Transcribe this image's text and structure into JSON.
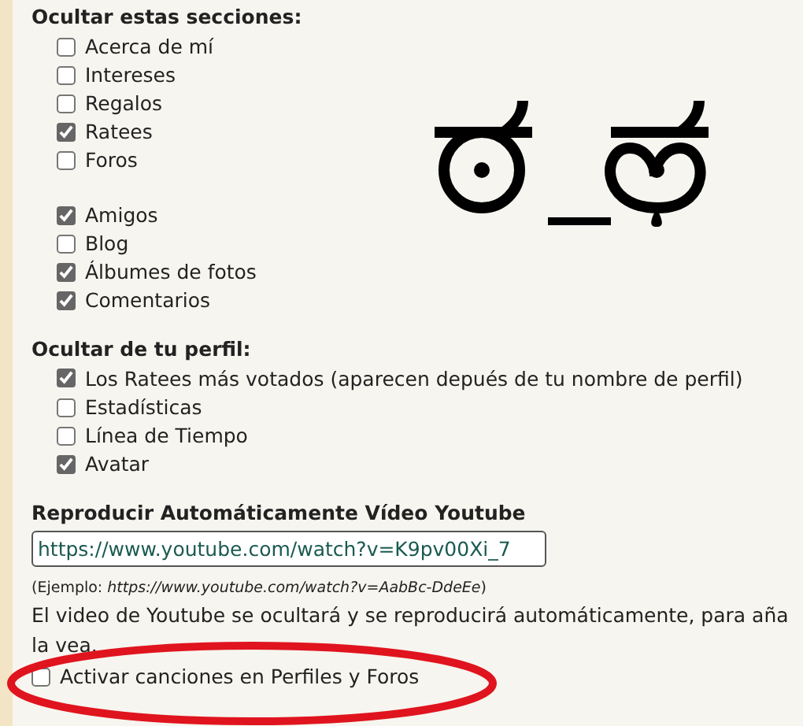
{
  "hide_sections": {
    "heading": "Ocultar estas secciones:",
    "groups": [
      [
        {
          "label": "Acerca de mí",
          "checked": false
        },
        {
          "label": "Intereses",
          "checked": false
        },
        {
          "label": "Regalos",
          "checked": false
        },
        {
          "label": "Ratees",
          "checked": true
        },
        {
          "label": "Foros",
          "checked": false
        }
      ],
      [
        {
          "label": "Amigos",
          "checked": true
        },
        {
          "label": "Blog",
          "checked": false
        },
        {
          "label": "Álbumes de fotos",
          "checked": true
        },
        {
          "label": "Comentarios",
          "checked": true
        }
      ]
    ]
  },
  "hide_profile": {
    "heading": "Ocultar de tu perfil:",
    "items": [
      {
        "label": "Los Ratees más votados (aparecen depués de tu nombre de perfil)",
        "checked": true
      },
      {
        "label": "Estadísticas",
        "checked": false
      },
      {
        "label": "Línea de Tiempo",
        "checked": false
      },
      {
        "label": "Avatar",
        "checked": true
      }
    ]
  },
  "youtube": {
    "heading": "Reproducir Automáticamente Vídeo Youtube",
    "value": "https://www.youtube.com/watch?v=K9pv00Xi_7",
    "example": "(Ejemplo: *https://www.youtube.com/watch?v=AabBc-DdeEe*)",
    "description_lines": [
      "El video de Youtube se ocultará y se reproducirá automáticamente, para aña",
      "la vea."
    ]
  },
  "songs": {
    "label": "Activar canciones en Perfiles y Foros",
    "checked": false
  }
}
